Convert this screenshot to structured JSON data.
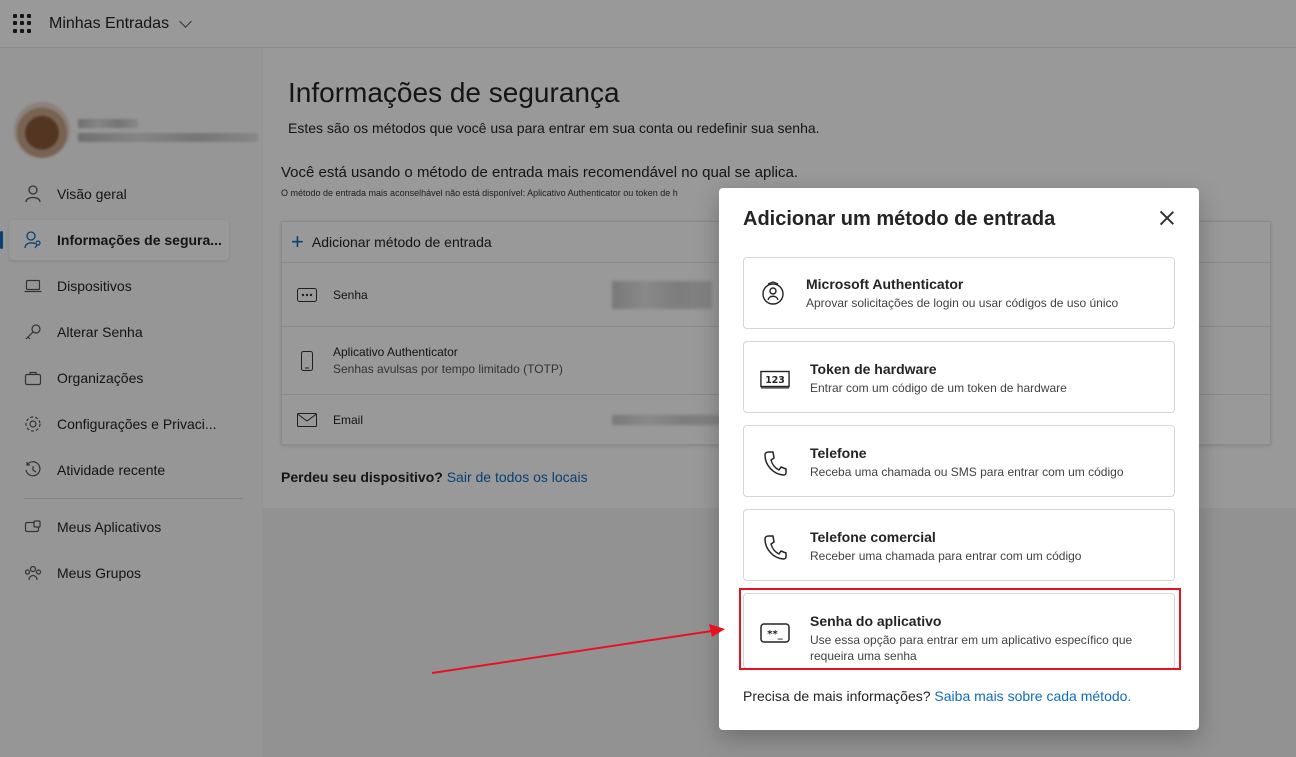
{
  "topbar": {
    "app_title": "Minhas Entradas"
  },
  "sidebar": {
    "items": [
      {
        "label": "Visão geral",
        "icon": "person-icon"
      },
      {
        "label": "Informações de segura...",
        "icon": "person-key-icon",
        "active": true
      },
      {
        "label": "Dispositivos",
        "icon": "laptop-icon"
      },
      {
        "label": "Alterar Senha",
        "icon": "key-icon"
      },
      {
        "label": "Organizações",
        "icon": "briefcase-icon"
      },
      {
        "label": "Configurações e Privaci...",
        "icon": "gear-icon"
      },
      {
        "label": "Atividade recente",
        "icon": "history-icon"
      }
    ],
    "secondary": [
      {
        "label": "Meus Aplicativos",
        "icon": "apps-icon"
      },
      {
        "label": "Meus Grupos",
        "icon": "people-icon"
      }
    ]
  },
  "main": {
    "title": "Informações de segurança",
    "subtitle": "Estes são os métodos que você usa para entrar em sua conta ou redefinir sua senha.",
    "recommendation": "Você está usando o método de entrada mais recomendável no qual se aplica.",
    "recommendation_small": "O método de entrada mais aconselhável não está disponível: Aplicativo Authenticator ou token de h",
    "add_method": "Adicionar método de entrada",
    "methods": [
      {
        "name": "Senha",
        "sub": "",
        "icon": "password-dots-icon"
      },
      {
        "name": "Aplicativo Authenticator",
        "sub": "Senhas avulsas por tempo limitado (TOTP)",
        "icon": "phone-icon"
      },
      {
        "name": "Email",
        "sub": "",
        "icon": "mail-icon"
      }
    ],
    "lost_device_label": "Perdeu seu dispositivo?",
    "lost_device_link": "Sair de todos os locais"
  },
  "dialog": {
    "title": "Adicionar um método de entrada",
    "options": [
      {
        "name": "Microsoft Authenticator",
        "desc": "Aprovar solicitações de login ou usar códigos de uso único",
        "icon": "authenticator-icon"
      },
      {
        "name": "Token de hardware",
        "desc": "Entrar com um código de um token de hardware",
        "icon": "hardware-token-icon",
        "icon_text": "123"
      },
      {
        "name": "Telefone",
        "desc": "Receba uma chamada ou SMS para entrar com um código",
        "icon": "phone-call-icon"
      },
      {
        "name": "Telefone comercial",
        "desc": "Receber uma chamada para entrar com um código",
        "icon": "phone-call-icon"
      },
      {
        "name": "Senha do aplicativo",
        "desc": "Use essa opção para entrar em um aplicativo específico que requeira uma senha",
        "icon": "app-password-icon",
        "icon_text": "**_"
      }
    ],
    "footer_text": "Precisa de mais informações?",
    "footer_link": "Saiba mais sobre cada método."
  },
  "colors": {
    "accent": "#0f6cbd",
    "highlight": "#e81123"
  }
}
